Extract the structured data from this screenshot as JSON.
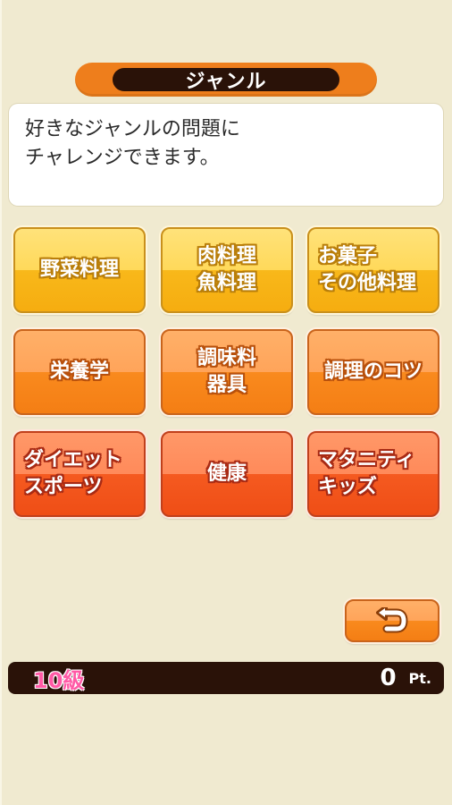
{
  "header": {
    "title": "ジャンル"
  },
  "description": {
    "lines": [
      "好きなジャンルの問題に",
      "チャレンジできます。"
    ]
  },
  "genres": [
    {
      "lines": [
        "野菜料理"
      ]
    },
    {
      "lines": [
        "肉料理",
        "魚料理"
      ]
    },
    {
      "lines": [
        "お菓子",
        "その他料理"
      ]
    },
    {
      "lines": [
        "栄養学"
      ]
    },
    {
      "lines": [
        "調味料",
        "器具"
      ]
    },
    {
      "lines": [
        "調理のコツ"
      ]
    },
    {
      "lines": [
        "ダイエット",
        "スポーツ"
      ]
    },
    {
      "lines": [
        "健康"
      ]
    },
    {
      "lines": [
        "マタニティ",
        "キッズ"
      ]
    }
  ],
  "back_button": {
    "icon": "return-arrow-icon"
  },
  "status": {
    "grade": "10級",
    "points": "0",
    "points_unit": "Pt."
  },
  "colors": {
    "background": "#f0ead0",
    "header_orange": "#ee7e1c",
    "header_dark": "#2a1208",
    "yellow_button": "#ffd95a",
    "orange_button": "#f98a1e",
    "red_button": "#f55a20",
    "grade_pink": "#ff5aa6"
  }
}
